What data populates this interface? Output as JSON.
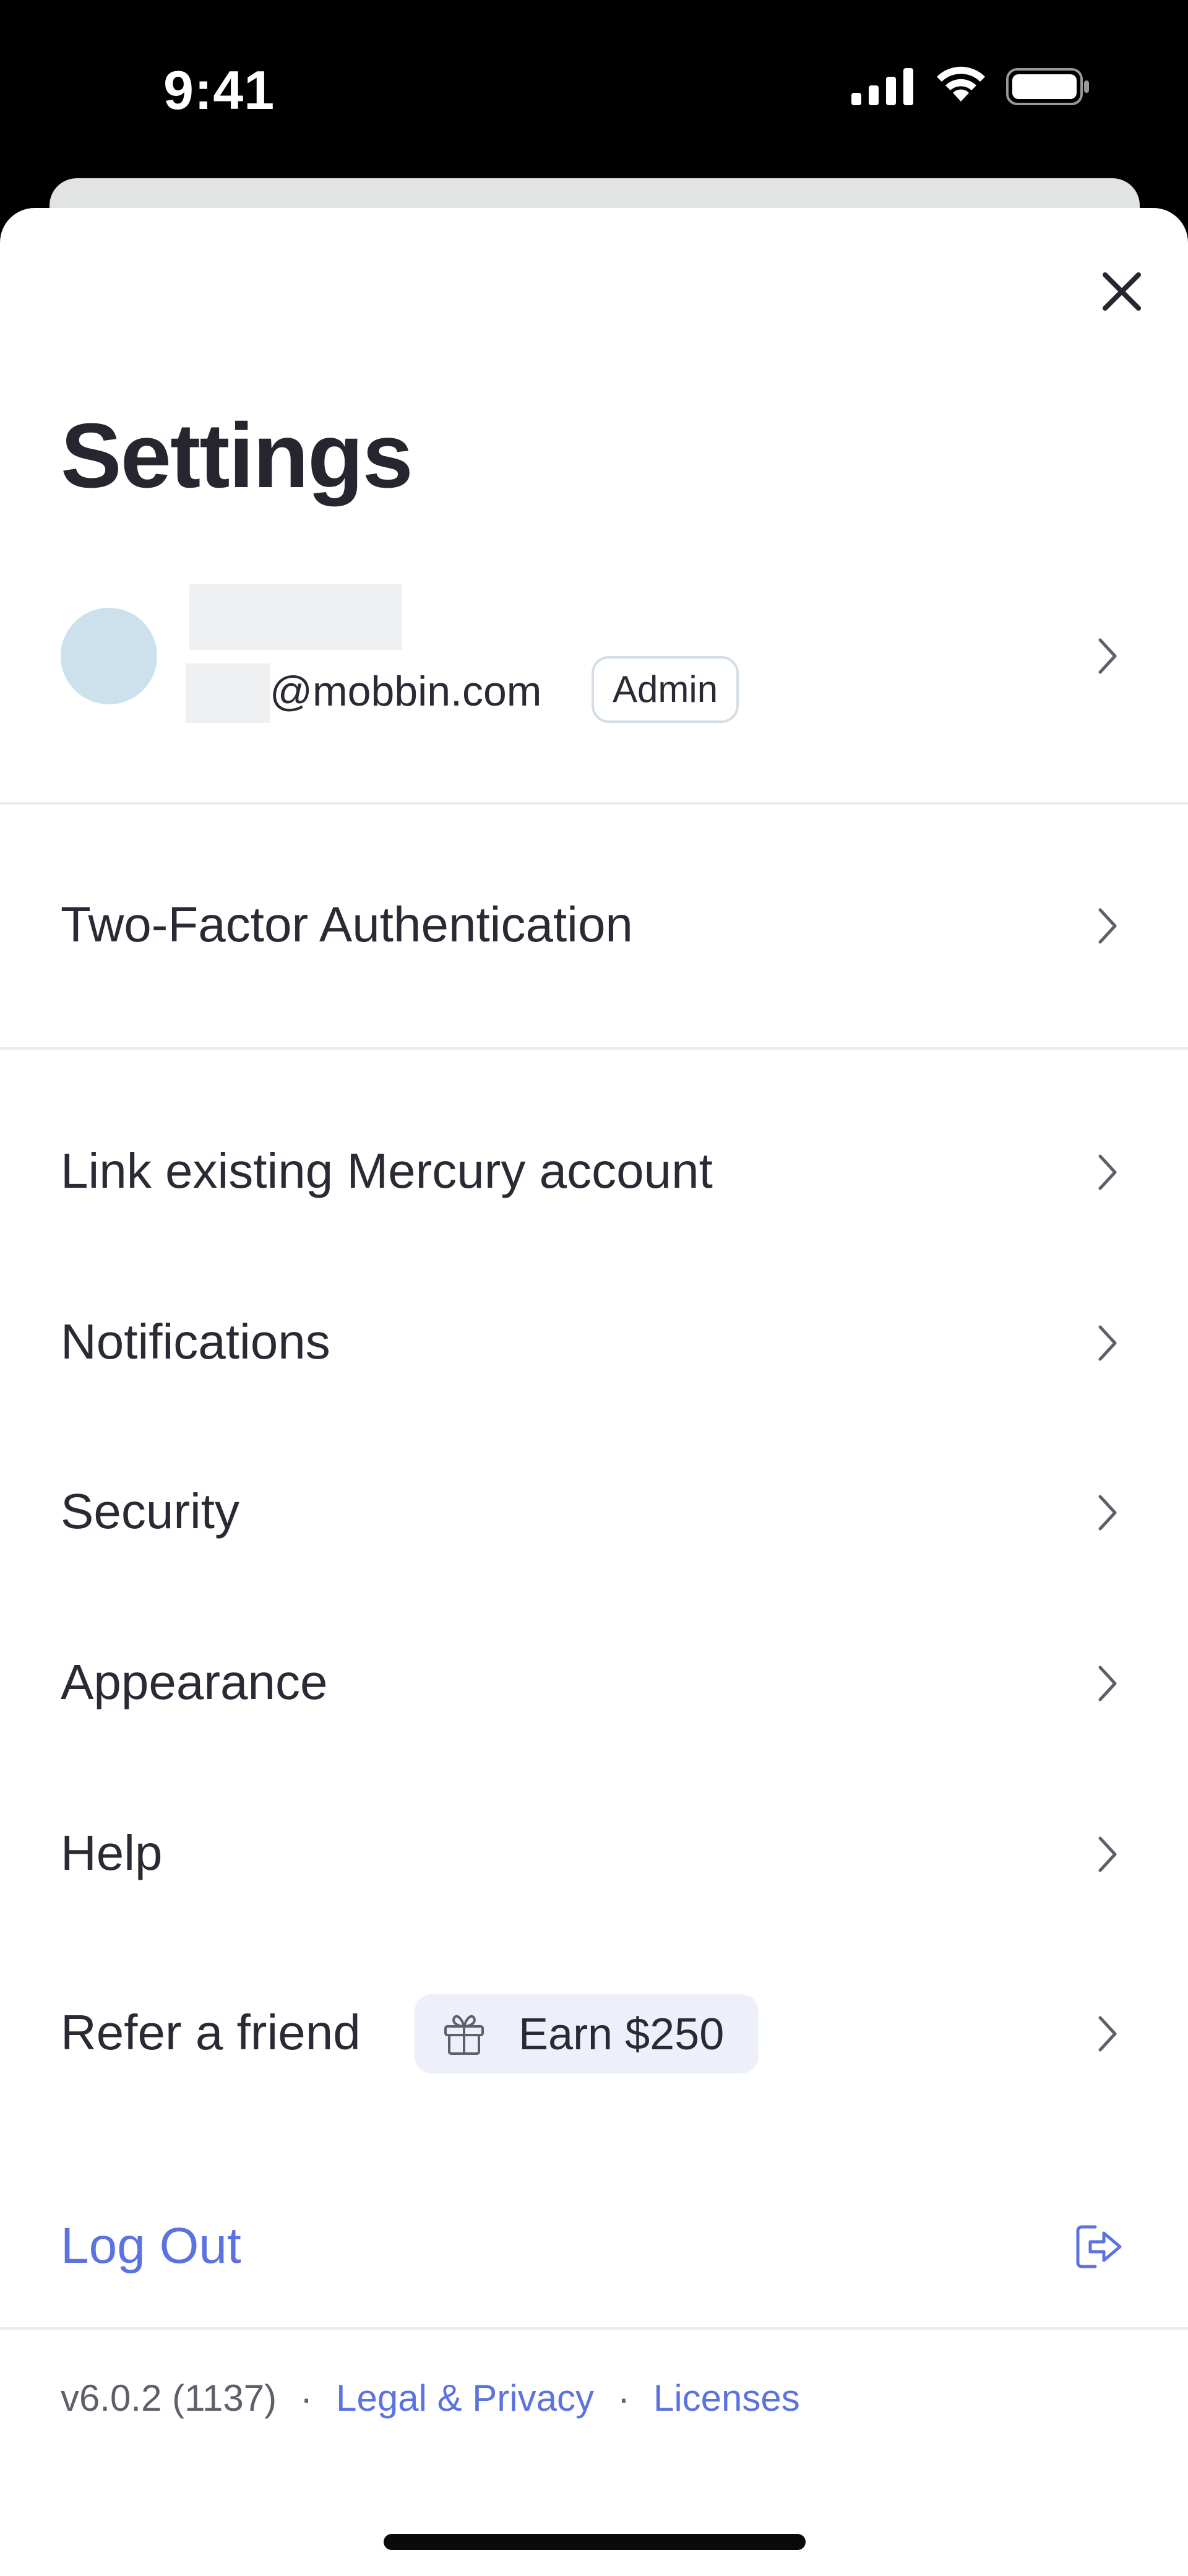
{
  "status_bar": {
    "time": "9:41"
  },
  "header": {
    "title": "Settings"
  },
  "profile": {
    "email_domain": "@mobbin.com",
    "role": "Admin"
  },
  "menu": {
    "two_factor": "Two-Factor Authentication",
    "link_account": "Link existing Mercury account",
    "notifications": "Notifications",
    "security": "Security",
    "appearance": "Appearance",
    "help": "Help",
    "refer_friend": "Refer a friend",
    "refer_badge": "Earn $250"
  },
  "logout": {
    "label": "Log Out"
  },
  "footer": {
    "version": "v6.0.2 (1137)",
    "separator": "·",
    "legal": "Legal & Privacy",
    "licenses": "Licenses"
  },
  "colors": {
    "accent": "#5b72e0",
    "text": "#2a2a35",
    "avatar": "#cde1ec",
    "badge_bg": "#edf0fb"
  }
}
